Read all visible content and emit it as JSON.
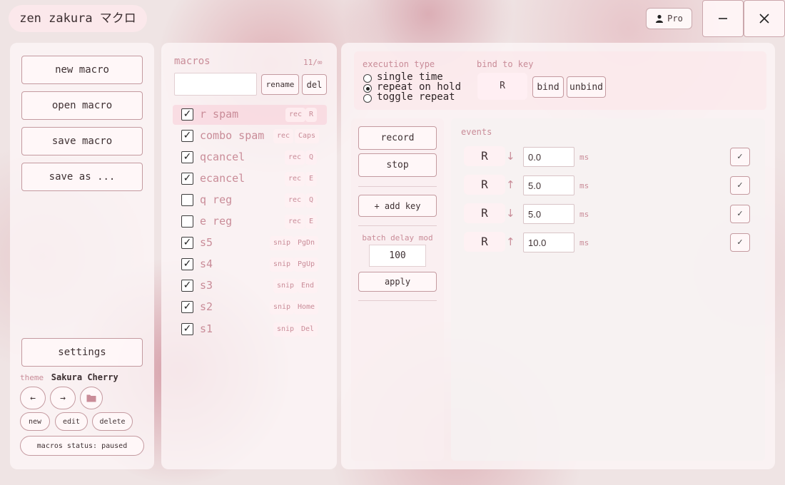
{
  "app": {
    "title": "zen zakura マクロ",
    "pro_label": "Pro"
  },
  "window": {
    "minimize_glyph": "–",
    "close_glyph": "✕"
  },
  "colors": {
    "accent": "#c98c98",
    "panel_bg": "#fcf4f5",
    "border": "#c49aa0"
  },
  "sidebar": {
    "new_macro": "new macro",
    "open_macro": "open macro",
    "save_macro": "save macro",
    "save_as": "save as ...",
    "settings": "settings",
    "theme_label": "theme",
    "theme_name": "Sakura Cherry",
    "prev_arrow": "←",
    "next_arrow": "→",
    "new": "new",
    "edit": "edit",
    "delete": "delete",
    "status": "macros status:  paused"
  },
  "macros": {
    "title": "macros",
    "count": "11/∞",
    "name_input_value": "",
    "rename": "rename",
    "del": "del",
    "items": [
      {
        "name": "r spam",
        "checked": true,
        "mode": "rec",
        "key": "R",
        "selected": true
      },
      {
        "name": "combo spam",
        "checked": true,
        "mode": "rec",
        "key": "Caps"
      },
      {
        "name": "qcancel",
        "checked": true,
        "mode": "rec",
        "key": "Q"
      },
      {
        "name": "ecancel",
        "checked": true,
        "mode": "rec",
        "key": "E"
      },
      {
        "name": "q reg",
        "checked": false,
        "mode": "rec",
        "key": "Q"
      },
      {
        "name": "e reg",
        "checked": false,
        "mode": "rec",
        "key": "E"
      },
      {
        "name": "s5",
        "checked": true,
        "mode": "snip",
        "key": "PgDn"
      },
      {
        "name": "s4",
        "checked": true,
        "mode": "snip",
        "key": "PgUp"
      },
      {
        "name": "s3",
        "checked": true,
        "mode": "snip",
        "key": "End"
      },
      {
        "name": "s2",
        "checked": true,
        "mode": "snip",
        "key": "Home"
      },
      {
        "name": "s1",
        "checked": true,
        "mode": "snip",
        "key": "Del"
      }
    ]
  },
  "execution": {
    "title": "execution type",
    "options": [
      "single time",
      "repeat on hold",
      "toggle repeat"
    ],
    "selected": "repeat on hold"
  },
  "bind": {
    "title": "bind to key",
    "key": "R",
    "bind": "bind",
    "unbind": "unbind"
  },
  "controls": {
    "record": "record",
    "stop": "stop",
    "add_key": "+ add key",
    "batch_label": "batch delay mod",
    "batch_value": "100",
    "apply": "apply"
  },
  "events": {
    "title": "events",
    "unit": "ms",
    "check_glyph": "✓",
    "rows": [
      {
        "key": "R",
        "dir": "↓",
        "delay": "0.0"
      },
      {
        "key": "R",
        "dir": "↑",
        "delay": "5.0"
      },
      {
        "key": "R",
        "dir": "↓",
        "delay": "5.0"
      },
      {
        "key": "R",
        "dir": "↑",
        "delay": "10.0"
      }
    ]
  }
}
